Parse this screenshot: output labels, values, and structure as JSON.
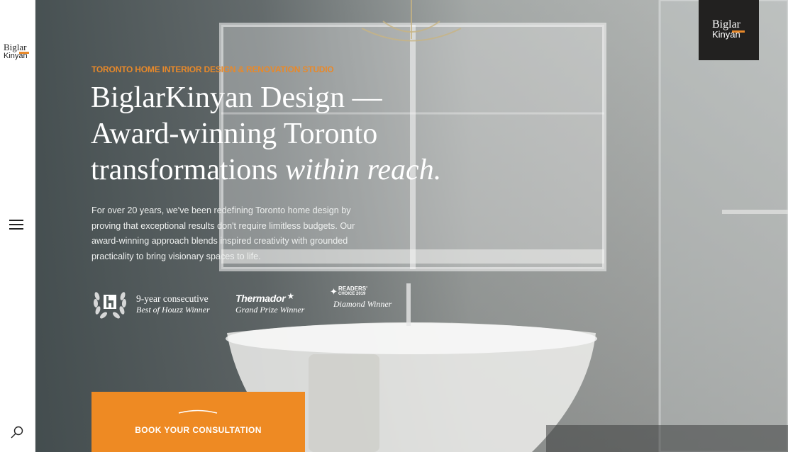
{
  "brand": {
    "line1": "Biglar",
    "line2": "Kinyan",
    "accent_color": "#e8892a"
  },
  "sidebar": {
    "menu_icon": "hamburger-icon",
    "search_icon": "magnifier-icon"
  },
  "hero": {
    "eyebrow": "TORONTO HOME INTERIOR DESIGN & RENOVATION STUDIO",
    "headline_line1": "BiglarKinyan Design —",
    "headline_line2": "Award-winning Toronto",
    "headline_line3_plain": "transformations ",
    "headline_line3_italic": "within reach.",
    "intro": "For over 20 years, we've been redefining Toronto home design by proving that exceptional results don't require limitless budgets. Our award-winning approach blends inspired creativity with grounded practicality to bring visionary spaces to life.",
    "cta_label": "BOOK YOUR CONSULTATION",
    "cta_color": "#ee8a23"
  },
  "awards": [
    {
      "icon": "houzz-laurel-icon",
      "line1": "9-year consecutive",
      "line2": "Best of Houzz Winner"
    },
    {
      "icon": "star-icon",
      "brand": "Thermador",
      "line2": "Grand Prize Winner"
    },
    {
      "icon": "readers-choice-icon",
      "line1a": "READERS'",
      "line1b": "CHOICE 2019",
      "line2": "Diamond Winner"
    }
  ]
}
